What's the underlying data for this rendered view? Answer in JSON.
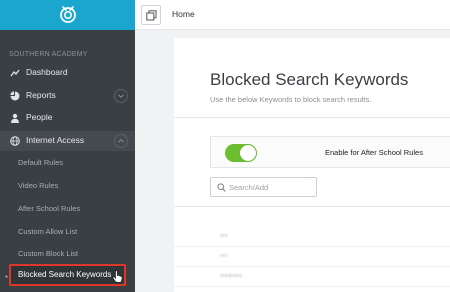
{
  "sidebar": {
    "org_name": "SOUTHERN ACADEMY",
    "items": [
      {
        "label": "Dashboard",
        "icon": "trend-icon"
      },
      {
        "label": "Reports",
        "icon": "pie-chart-icon"
      },
      {
        "label": "People",
        "icon": "person-icon"
      },
      {
        "label": "Internet Access",
        "icon": "globe-icon"
      }
    ],
    "sub_items": [
      {
        "label": "Default Rules"
      },
      {
        "label": "Video Rules"
      },
      {
        "label": "After School Rules"
      },
      {
        "label": "Custom Allow List"
      },
      {
        "label": "Custom Block List"
      },
      {
        "label": "Blocked Search Keywords"
      }
    ]
  },
  "topbar": {
    "breadcrumb": "Home"
  },
  "main": {
    "title": "Blocked Search Keywords",
    "subtitle": "Use the below Keywords to block search results.",
    "toggle_label": "Enable for After School Rules",
    "search_placeholder": "Search/Add",
    "keywords": [
      "sex",
      "xxx",
      "marijuana"
    ]
  },
  "colors": {
    "brand": "#1aa6cf",
    "sidebar_bg": "#3a3f44",
    "toggle_on": "#6bbe2f",
    "highlight": "#e0352b"
  }
}
